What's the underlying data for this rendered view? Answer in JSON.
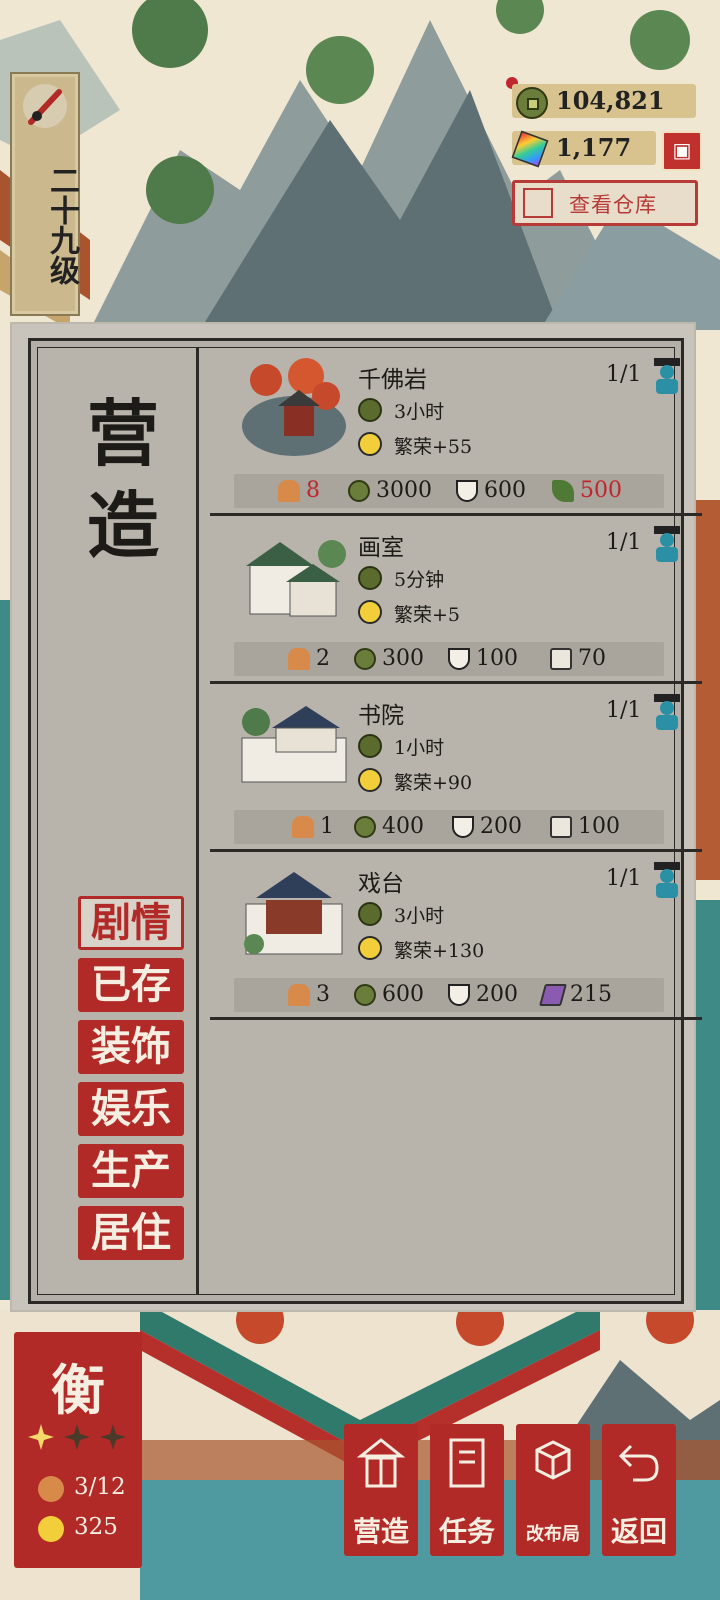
{
  "level": {
    "label": "二十九级"
  },
  "resources": {
    "coins": "104,821",
    "jade": "1,177",
    "warehouse_label": "查看仓库"
  },
  "panel": {
    "title": "营造",
    "categories": [
      {
        "label": "剧情",
        "active": true
      },
      {
        "label": "已存",
        "active": false
      },
      {
        "label": "装饰",
        "active": false
      },
      {
        "label": "娱乐",
        "active": false
      },
      {
        "label": "生产",
        "active": false
      },
      {
        "label": "居住",
        "active": false
      }
    ],
    "buildings": [
      {
        "name": "千佛岩",
        "count": "1/1",
        "time": "3小时",
        "prosperity": "繁荣+55",
        "costs": {
          "workers": "8",
          "coins": "3000",
          "food": "600",
          "material": "500",
          "material_icon": "plant-icon"
        }
      },
      {
        "name": "画室",
        "count": "1/1",
        "time": "5分钟",
        "prosperity": "繁荣+5",
        "costs": {
          "workers": "2",
          "coins": "300",
          "food": "100",
          "material": "70",
          "material_icon": "scroll-icon"
        }
      },
      {
        "name": "书院",
        "count": "1/1",
        "time": "1小时",
        "prosperity": "繁荣+90",
        "costs": {
          "workers": "1",
          "coins": "400",
          "food": "200",
          "material": "100",
          "material_icon": "scroll-icon"
        }
      },
      {
        "name": "戏台",
        "count": "1/1",
        "time": "3小时",
        "prosperity": "繁荣+130",
        "costs": {
          "workers": "3",
          "coins": "600",
          "food": "200",
          "material": "215",
          "material_icon": "cloth-icon"
        }
      }
    ]
  },
  "residence": {
    "name": "衡",
    "stars_filled": 1,
    "stars_total": 3,
    "population": "3/12",
    "prosperity": "325"
  },
  "nav": {
    "build": "营造",
    "tasks": "任务",
    "layout": "改布局",
    "back": "返回"
  },
  "colors": {
    "accent_red": "#b22a27",
    "warning_red": "#c0262d"
  }
}
